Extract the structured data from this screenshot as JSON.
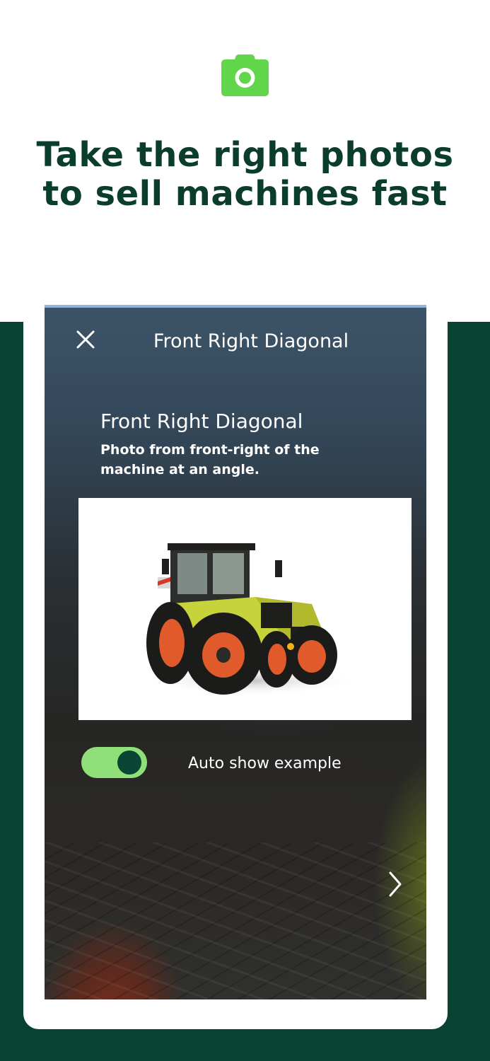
{
  "header": {
    "icon": "camera-icon",
    "headline_line1": "Take the right photos",
    "headline_line2": "to sell machines fast"
  },
  "colors": {
    "brand_green": "#62d64a",
    "headline_green": "#0b3d2e",
    "band_dark_green": "#084233",
    "toggle_track": "#90e07a",
    "toggle_knob": "#0b4534"
  },
  "screen": {
    "top_bar": {
      "close_icon": "close-icon",
      "title": "Front Right Diagonal"
    },
    "overlay": {
      "title": "Front Right Diagonal",
      "description": "Photo from front-right of the machine at an angle."
    },
    "example_image": "tractor-example",
    "auto_show": {
      "label": "Auto show example",
      "enabled": true
    },
    "next_icon": "chevron-right-icon"
  }
}
